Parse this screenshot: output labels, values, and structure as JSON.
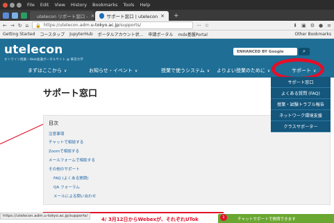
{
  "os": {
    "menu": [
      "File",
      "Edit",
      "View",
      "History",
      "Bookmarks",
      "Tools",
      "Help"
    ]
  },
  "browser": {
    "tabs": [
      {
        "label": "utelecon リポート窓口 -",
        "active": false
      },
      {
        "label": "サポート窓口 | utelecon",
        "active": true
      }
    ],
    "new_tab": "+",
    "url_prefix": "https://utelecon.adm.",
    "url_domain": "u-tokyo.ac.jp",
    "url_suffix": "/supports/",
    "bookmarks": [
      "Getting Started",
      "コースタップ",
      "JupyterHub",
      "ポータルアカウント状...",
      "申請ポータル",
      "mdx基盤Portal"
    ],
    "other_bookmarks": "Other Bookmarks"
  },
  "site": {
    "logo": "utelecon",
    "logo_sub": "オンライン授業・Web会議ポータルサイト @ 東京大学",
    "search_label": "ENHANCED BY Google",
    "nav": [
      {
        "label": "まずはここから"
      },
      {
        "label": "お知らせ・イベント"
      },
      {
        "label": "授業で使うシステム"
      },
      {
        "label": "よりよい授業のために"
      },
      {
        "label": "サポート"
      }
    ],
    "dropdown": [
      "サポート窓口",
      "よくある質問 (FAQ)",
      "授業・試験トラブル報告",
      "ネットワーク環境支援",
      "クラスサポーター"
    ]
  },
  "content": {
    "page_title": "サポート窓口",
    "toc_head": "目次",
    "toc_links": [
      "注意事項",
      "チャットで相談する",
      "Zoomで相談する",
      "メールフォームで相談する",
      "その他のサポート",
      "FAQ (よくある質問)",
      "QA フォーラム",
      "メールによる問い合わせ"
    ]
  },
  "status": {
    "url": "https://utelecon.adm.u-tokyo.ac.jp/supports/",
    "banner": "4/ 3月12日からWebexが、それぞれUTok",
    "chat": "チャットサポートで質問できます",
    "chat_badge": "1"
  }
}
